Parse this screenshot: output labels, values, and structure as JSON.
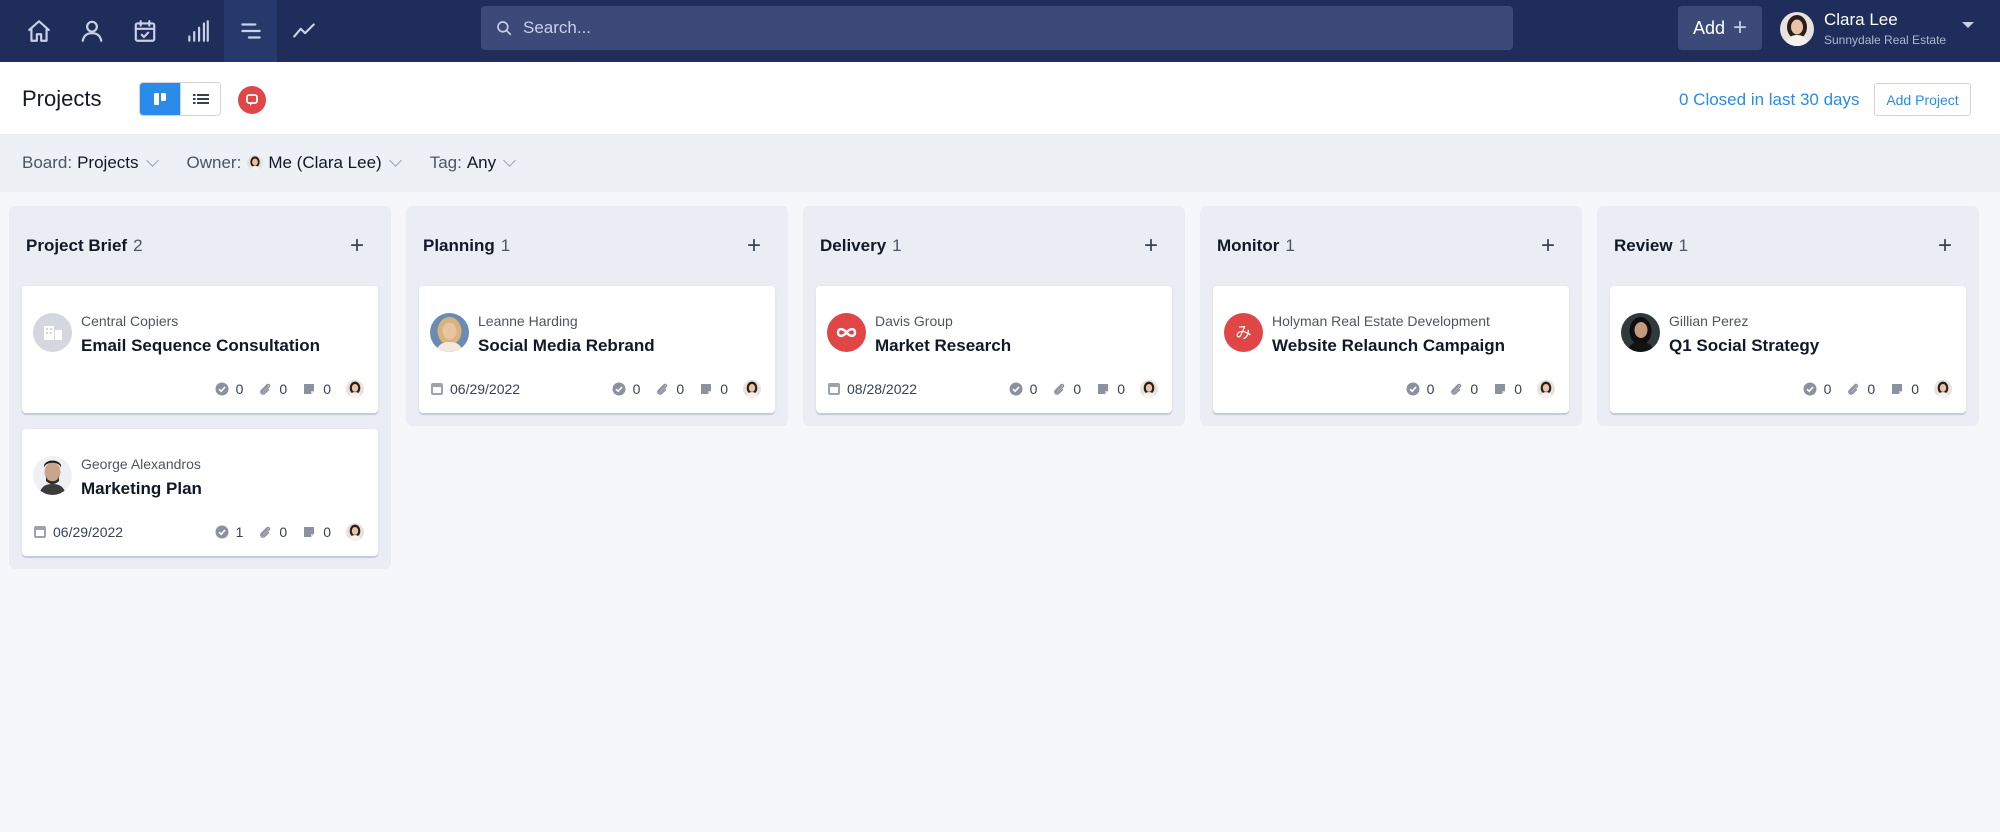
{
  "nav": {
    "items": [
      "home-icon",
      "person-icon",
      "calendar-check-icon",
      "bar-chart-icon",
      "projects-icon",
      "trend-line-icon"
    ],
    "active_index": 4
  },
  "search": {
    "placeholder": "Search..."
  },
  "add_button": {
    "label": "Add"
  },
  "user": {
    "name": "Clara Lee",
    "org": "Sunnydale Real Estate"
  },
  "page": {
    "title": "Projects",
    "closed_link": "0 Closed in last 30 days",
    "add_project": "Add Project"
  },
  "filters": {
    "board_label": "Board:",
    "board_value": "Projects",
    "owner_label": "Owner:",
    "owner_value": "Me (Clara Lee)",
    "tag_label": "Tag:",
    "tag_value": "Any"
  },
  "colors": {
    "nav_bg": "#1e2d5a",
    "accent": "#2a8be8",
    "red": "#e04646"
  },
  "columns": [
    {
      "title": "Project Brief",
      "count": "2",
      "cards": [
        {
          "client": "Central Copiers",
          "title": "Email Sequence Consultation",
          "date": "",
          "checks": "0",
          "attachments": "0",
          "notes": "0",
          "avatar": "building"
        },
        {
          "client": "George Alexandros",
          "title": "Marketing Plan",
          "date": "06/29/2022",
          "checks": "1",
          "attachments": "0",
          "notes": "0",
          "avatar": "man"
        }
      ]
    },
    {
      "title": "Planning",
      "count": "1",
      "cards": [
        {
          "client": "Leanne Harding",
          "title": "Social Media Rebrand",
          "date": "06/29/2022",
          "checks": "0",
          "attachments": "0",
          "notes": "0",
          "avatar": "woman-blonde"
        }
      ]
    },
    {
      "title": "Delivery",
      "count": "1",
      "cards": [
        {
          "client": "Davis Group",
          "title": "Market Research",
          "date": "08/28/2022",
          "checks": "0",
          "attachments": "0",
          "notes": "0",
          "avatar": "infinity-logo"
        }
      ]
    },
    {
      "title": "Monitor",
      "count": "1",
      "cards": [
        {
          "client": "Holyman Real Estate Development",
          "title": "Website Relaunch Campaign",
          "date": "",
          "checks": "0",
          "attachments": "0",
          "notes": "0",
          "avatar": "glyph-logo"
        }
      ]
    },
    {
      "title": "Review",
      "count": "1",
      "cards": [
        {
          "client": "Gillian Perez",
          "title": "Q1 Social Strategy",
          "date": "",
          "checks": "0",
          "attachments": "0",
          "notes": "0",
          "avatar": "woman-dark"
        }
      ]
    }
  ]
}
